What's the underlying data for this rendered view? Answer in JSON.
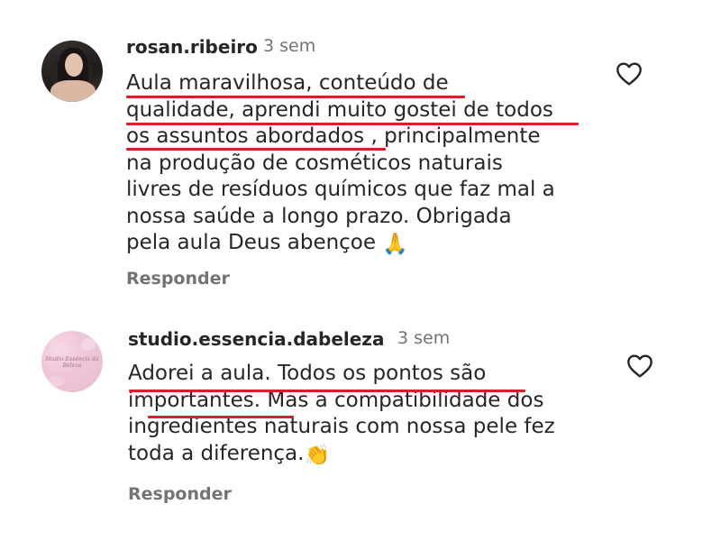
{
  "comments": [
    {
      "username": "rosan.ribeiro",
      "time": "3 sem",
      "lines": [
        "Aula maravilhosa, conteúdo de",
        "qualidade, aprendi muito gostei de todos",
        "os assuntos abordados , principalmente",
        "na produção de cosméticos naturais",
        "livres de resíduos químicos que faz mal a",
        "nossa saúde a longo prazo. Obrigada",
        "pela aula Deus abençoe"
      ],
      "emoji": "🙏",
      "emoji_name": "folded-hands-icon",
      "reply_label": "Responder",
      "liked": false
    },
    {
      "username": "studio.essencia.dabeleza",
      "time": "3 sem",
      "avatar_text": "Studio Essência da Beleza",
      "lines": [
        "Adorei a aula. Todos os pontos são",
        "importantes. Mas a compatibilidade dos",
        "ingredientes naturais com nossa pele fez",
        "toda a diferença."
      ],
      "emoji": "👏",
      "emoji_name": "clapping-hands-icon",
      "reply_label": "Responder",
      "liked": false
    }
  ],
  "colors": {
    "text": "#262626",
    "muted": "#737373",
    "annotation_underline": "#d41f2c"
  }
}
